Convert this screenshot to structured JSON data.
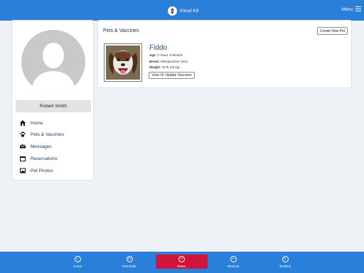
{
  "app": {
    "title": "Kloud K9",
    "menu_label": "Menu"
  },
  "profile": {
    "name": "Robert Smith"
  },
  "sidebar": {
    "items": [
      {
        "label": "Home",
        "icon": "home-icon"
      },
      {
        "label": "Pets & Vaccines",
        "icon": "paw-icon"
      },
      {
        "label": "Messages",
        "icon": "envelope-icon"
      },
      {
        "label": "Reservations",
        "icon": "calendar-icon"
      },
      {
        "label": "Pet Photos",
        "icon": "photo-icon"
      }
    ]
  },
  "pets": {
    "title": "Pets & Vaccines",
    "create_button": "Create New Pet",
    "pet": {
      "name": "Fiddo",
      "age_label": "Age:",
      "age": "3 Years, 8 Months",
      "breed_label": "Breed:",
      "breed": "Affenpinscher (mix)",
      "weight_label": "Weight:",
      "weight": "34 lb (15 kg)",
      "vaccines_button": "View Or Update Vaccines"
    }
  },
  "bottom_nav": {
    "tabs": [
      {
        "label": "Home",
        "icon": "home-icon"
      },
      {
        "label": "Reminder",
        "icon": "clock-icon"
      },
      {
        "label": "Share",
        "icon": "share-icon",
        "active": true
      },
      {
        "label": "Reserve",
        "icon": "plus-icon"
      },
      {
        "label": "Timeline",
        "icon": "timeline-icon"
      }
    ]
  },
  "colors": {
    "primary": "#2a7fd8",
    "active_tab": "#d0153a",
    "background": "#eef2f6"
  }
}
